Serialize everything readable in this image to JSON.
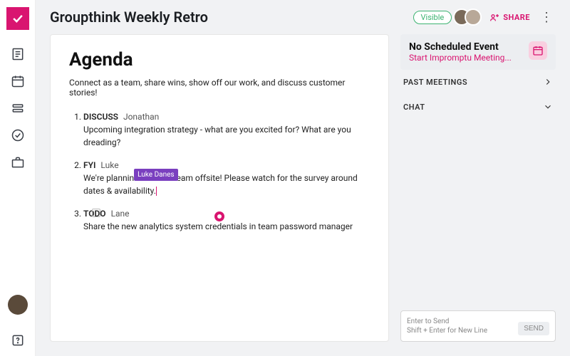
{
  "header": {
    "title": "Groupthink Weekly Retro",
    "visible_badge": "Visible",
    "share_label": "SHARE"
  },
  "doc": {
    "heading": "Agenda",
    "intro": "Connect as a team, share wins, show off our work, and discuss customer stories!",
    "items": [
      {
        "tag": "DISCUSS",
        "author": "Jonathan",
        "body": "Upcoming integration strategy - what are you excited for? What are you dreading?"
      },
      {
        "tag": "FYI",
        "author": "Luke",
        "body_before": "We're plannin",
        "body_after": "xt team offsite! Please watch for the survey around dates & availability."
      },
      {
        "tag": "TODO",
        "author": "Lane",
        "body": "Share the new analytics system credentials in team password manager"
      }
    ],
    "presence_label": "Luke Danes"
  },
  "rail": {
    "event": {
      "title": "No Scheduled Event",
      "link": "Start Impromptu Meeting..."
    },
    "sections": {
      "past": "PAST MEETINGS",
      "chat": "CHAT"
    },
    "chat": {
      "hint1": "Enter to Send",
      "hint2": "Shift + Enter for New Line",
      "send": "SEND"
    }
  }
}
